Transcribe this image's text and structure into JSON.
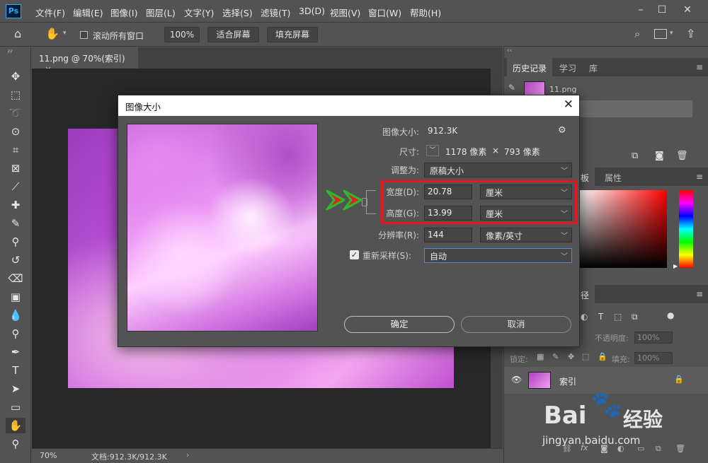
{
  "app": {
    "logo": "Ps"
  },
  "menu": [
    "文件(F)",
    "编辑(E)",
    "图像(I)",
    "图层(L)",
    "文字(Y)",
    "选择(S)",
    "滤镜(T)",
    "3D(D)",
    "视图(V)",
    "窗口(W)",
    "帮助(H)"
  ],
  "options": {
    "scroll_all": "滚动所有窗口",
    "zoom": "100%",
    "fit_screen": "适合屏幕",
    "fill_screen": "填充屏幕"
  },
  "document": {
    "tab_title": "11.png @ 70%(索引)",
    "zoom": "70%",
    "doc_info": "文档:912.3K/912.3K"
  },
  "panels": {
    "history_tabs": [
      "历史记录",
      "学习",
      "库"
    ],
    "history_item": "11.png",
    "color_tabs": [
      "板",
      "属性"
    ],
    "layers_tab": "径",
    "opacity_label": "不透明度:",
    "opacity_value": "100%",
    "lock_label": "锁定:",
    "fill_label": "填充:",
    "fill_value": "100%",
    "layer_name": "索引"
  },
  "dialog": {
    "title": "图像大小",
    "image_size_label": "图像大小:",
    "image_size_value": "912.3K",
    "dimensions_label": "尺寸:",
    "dimensions_width": "1178 像素",
    "dimensions_x": "×",
    "dimensions_height": "793 像素",
    "fit_to_label": "调整为:",
    "fit_to_value": "原稿大小",
    "width_label": "宽度(D):",
    "width_value": "20.78",
    "width_unit": "厘米",
    "height_label": "高度(G):",
    "height_value": "13.99",
    "height_unit": "厘米",
    "resolution_label": "分辨率(R):",
    "resolution_value": "144",
    "resolution_unit": "像素/英寸",
    "resample_label": "重新采样(S):",
    "resample_value": "自动",
    "ok_label": "确定",
    "cancel_label": "取消"
  },
  "watermark": {
    "brand": "Bai",
    "brand2": "经验",
    "url": "jingyan.baidu.com"
  },
  "colors": {
    "highlight": "#e8161e",
    "arrow_fill": "#e81c1c",
    "arrow_stroke": "#2fb82f"
  }
}
